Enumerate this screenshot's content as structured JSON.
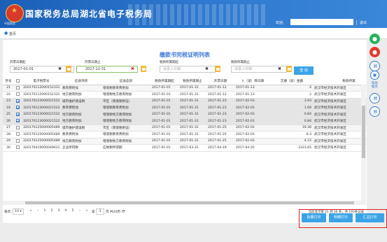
{
  "header": {
    "site_title": "国家税务总局湖北省电子税务局",
    "emblem_text": "中国税务",
    "welcome_label": "欢迎,",
    "logout_label": "退出"
  },
  "breadcrumb": {
    "home": "首页"
  },
  "page": {
    "title": "缴款书完税证明列表"
  },
  "filters": {
    "start_date": {
      "label": "开票日期起",
      "value": "2017-01-01"
    },
    "end_date": {
      "label": "开票日期止",
      "value": "2017-12-31"
    },
    "tax_start": {
      "label": "税款所属期起",
      "placeholder": "请录入日期"
    },
    "tax_end": {
      "label": "税款所属期止",
      "placeholder": "请录入日期"
    },
    "clear_symbol": "✖",
    "query_button": "查 询"
  },
  "table": {
    "columns": [
      "序号",
      "",
      "电子税票号",
      "征收项目",
      "征收品目",
      "税款所属期起",
      "税款所属期止",
      "开票日期",
      "入（退）库日期",
      "实缴（退）金额",
      "税款所属"
    ],
    "rows": [
      {
        "no": "21",
        "checked": false,
        "ticket": "320170112000152331",
        "item": "教育费附加",
        "subitem": "增值税教育费附加",
        "p_start": "2017-01-01",
        "p_end": "2017-01-31",
        "issue": "2017-01-12",
        "stock": "2017-01-13",
        "amount": "4",
        "org": "武汉市经济技术开发区"
      },
      {
        "no": "22",
        "checked": false,
        "ticket": "320170112000152331",
        "item": "地方教育附加",
        "subitem": "增值税地方教育附加",
        "p_start": "2017-01-01",
        "p_end": "2017-01-31",
        "issue": "2017-01-12",
        "stock": "2017-01-13",
        "amount": "2",
        "org": "武汉市经济技术开发区"
      },
      {
        "no": "23",
        "checked": true,
        "ticket": "320170123000021522",
        "item": "城市维护建设税",
        "subitem": "市区（增值税附征）",
        "p_start": "2017-01-01",
        "p_end": "2017-01-31",
        "issue": "2017-01-23",
        "stock": "2017-02-03",
        "amount": "3.93",
        "org": "武汉市经济技术开发区"
      },
      {
        "no": "24",
        "checked": true,
        "ticket": "320170123000021522",
        "item": "教育费附加",
        "subitem": "增值税教育费附加",
        "p_start": "2017-01-01",
        "p_end": "2017-01-31",
        "issue": "2017-01-23",
        "stock": "2017-02-03",
        "amount": "1.69",
        "org": "武汉市经济技术开发区"
      },
      {
        "no": "25",
        "checked": true,
        "ticket": "320170123000021522",
        "item": "地方教育附加",
        "subitem": "增值税地方教育附加",
        "p_start": "2017-01-01",
        "p_end": "2017-01-31",
        "issue": "2017-01-23",
        "stock": "2017-02-03",
        "amount": "0.84",
        "org": "武汉市经济技术开发区"
      },
      {
        "no": "26",
        "checked": true,
        "ticket": "320170123000021522",
        "item": "地方教育附加",
        "subitem": "增值税地方教育附加",
        "p_start": "2017-01-01",
        "p_end": "2017-01-31",
        "issue": "2017-01-23",
        "stock": "2017-02-03",
        "amount": "0.84",
        "org": "武汉市经济技术开发区"
      },
      {
        "no": "27",
        "checked": false,
        "ticket": "320170125000005489",
        "item": "城市维护建设税",
        "subitem": "市区（增值税附征）",
        "p_start": "2017-01-01",
        "p_end": "2017-01-31",
        "issue": "2017-01-25",
        "stock": "2017-02-03",
        "amount": "19.36",
        "org": "武汉市经济技术开发区"
      },
      {
        "no": "28",
        "checked": false,
        "ticket": "320170125000005489",
        "item": "教育费附加",
        "subitem": "增值税教育费附加",
        "p_start": "2017-01-01",
        "p_end": "2017-01-31",
        "issue": "2017-01-25",
        "stock": "2017-02-03",
        "amount": "8.3",
        "org": "武汉市经济技术开发区"
      },
      {
        "no": "29",
        "checked": false,
        "ticket": "320170125000005489",
        "item": "地方教育附加",
        "subitem": "增值税地方教育附加",
        "p_start": "2017-01-01",
        "p_end": "2017-01-31",
        "issue": "2017-01-25",
        "stock": "2017-02-03",
        "amount": "4.15",
        "org": "武汉市经济技术开发区"
      },
      {
        "no": "30",
        "checked": false,
        "ticket": "320170419000049612",
        "item": "企业所得税",
        "subitem": "应纳税所得额",
        "p_start": "2017-01-01",
        "p_end": "2017-03-31",
        "issue": "2017-04-19",
        "stock": "2017-04-20",
        "amount": "3323.65",
        "org": "武汉市经济技术开发区"
      }
    ]
  },
  "pager": {
    "page_size_label": "每页",
    "page_size": "10",
    "first": "«",
    "prev": "‹",
    "pages": [
      "1",
      "2",
      "3",
      "4",
      "5"
    ],
    "next": "›",
    "last": "»",
    "goto_label": "第",
    "current_page": "3",
    "total_pages": "页 共20页",
    "refresh_icon": "⟳",
    "info": "当前显示第 21 到 30 条，共 193条记录"
  },
  "actions": {
    "batch_print": "批量打印",
    "detail_print": "明细打印",
    "summary_print": "汇总打印"
  },
  "sidebar": {
    "help_label": "帮助服务"
  },
  "colors": {
    "header_blue": "#2f7ad0",
    "button_blue": "#3ba3e8",
    "title_blue": "#3b79d9",
    "highlight_red": "#e02020",
    "calendar_orange": "#f2b63c",
    "clear_red": "#c82323",
    "clear_dark": "#333333"
  }
}
